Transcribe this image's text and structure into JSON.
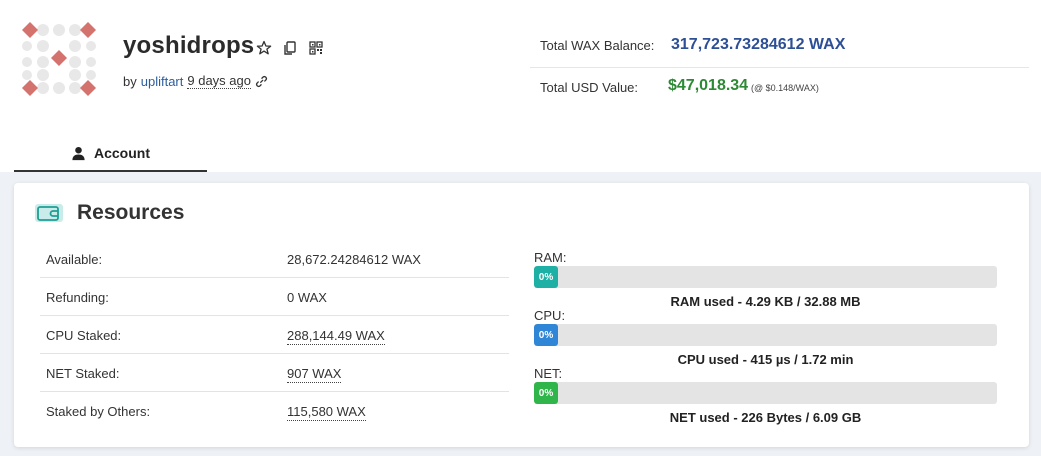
{
  "account": {
    "name": "yoshidrops",
    "created_by_prefix": "by",
    "creator": "upliftart",
    "created_ago": "9 days ago"
  },
  "balances": {
    "wax_label": "Total WAX Balance:",
    "wax_value": "317,723.73284612 WAX",
    "usd_label": "Total USD Value:",
    "usd_value": "$47,018.34",
    "usd_rate": "(@ $0.148/WAX)"
  },
  "tabs": [
    {
      "label": "Account",
      "icon": "user-icon",
      "active": true
    }
  ],
  "resources": {
    "title": "Resources",
    "icon": "wallet-icon",
    "rows": [
      {
        "label": "Available:",
        "value": "28,672.24284612 WAX"
      },
      {
        "label": "Refunding:",
        "value": "0 WAX"
      },
      {
        "label": "CPU Staked:",
        "value": "288,144.49 WAX"
      },
      {
        "label": "NET Staked:",
        "value": "907 WAX"
      },
      {
        "label": "Staked by Others:",
        "value": "115,580 WAX"
      }
    ],
    "meters": {
      "ram": {
        "label": "RAM:",
        "percent": "0%",
        "fraction": 0,
        "color": "#1eb0a4",
        "summary": "RAM used - 4.29 KB / 32.88 MB"
      },
      "cpu": {
        "label": "CPU:",
        "percent": "0%",
        "fraction": 0,
        "color": "#2f86d6",
        "summary": "CPU used - 415 µs / 1.72 min"
      },
      "net": {
        "label": "NET:",
        "percent": "0%",
        "fraction": 0,
        "color": "#2fb54a",
        "summary": "NET used - 226 Bytes / 6.09 GB"
      }
    }
  },
  "colors": {
    "wax_balance": "#2c4f95",
    "usd_value": "#2d8a34",
    "avatar_red": "#d4736d",
    "avatar_grey": "#e9e9e9"
  }
}
